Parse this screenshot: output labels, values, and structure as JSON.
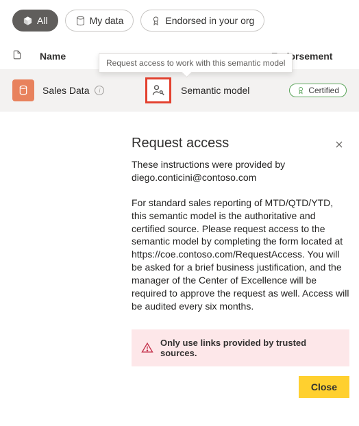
{
  "filters": {
    "all": "All",
    "my_data": "My data",
    "endorsed": "Endorsed in your org"
  },
  "columns": {
    "name": "Name",
    "endorsement": "Endorsement"
  },
  "tooltip": "Request access to work with this semantic model",
  "row": {
    "name": "Sales Data",
    "type": "Semantic model",
    "badge": "Certified"
  },
  "popover": {
    "title": "Request access",
    "intro": "These instructions were provided by diego.conticini@contoso.com",
    "body": "For standard sales reporting of MTD/QTD/YTD, this semantic model is the authoritative and certified source. Please request access to the semantic model by completing the form located at https://coe.contoso.com/RequestAccess. You will be asked for a brief business justification, and the manager of the Center of Excellence will be required to approve the request as well. Access will be audited every six months.",
    "alert": "Only use links provided by trusted sources.",
    "close": "Close"
  }
}
